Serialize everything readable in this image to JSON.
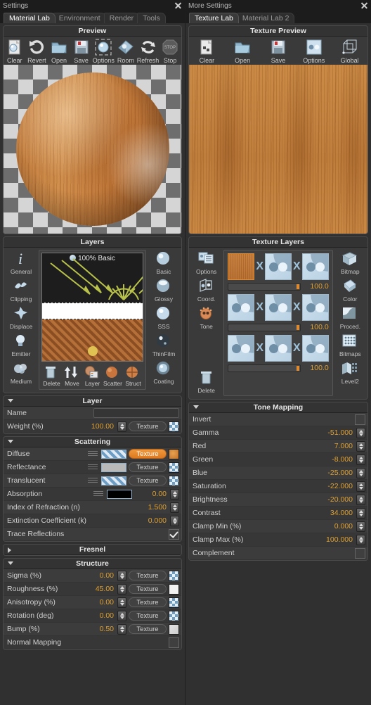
{
  "left_window": {
    "title": "Settings",
    "close_icon": "close-icon",
    "tabs": [
      {
        "label": "Material Lab",
        "active": true
      },
      {
        "label": "Environment",
        "active": false
      },
      {
        "label": "Render",
        "active": false
      },
      {
        "label": "Tools",
        "active": false
      }
    ],
    "preview": {
      "header": "Preview",
      "tools": [
        {
          "label": "Clear",
          "icon": "clear-icon"
        },
        {
          "label": "Revert",
          "icon": "revert-icon"
        },
        {
          "label": "Open",
          "icon": "folder-open-icon"
        },
        {
          "label": "Save",
          "icon": "floppy-save-icon"
        },
        {
          "label": "Options",
          "icon": "options-sphere-icon"
        },
        {
          "label": "Room",
          "icon": "room-icon"
        },
        {
          "label": "Refresh",
          "icon": "refresh-icon"
        },
        {
          "label": "Stop",
          "icon": "stop-icon"
        }
      ]
    },
    "layers": {
      "header": "Layers",
      "left_icons": [
        {
          "label": "General",
          "icon": "info-i-icon"
        },
        {
          "label": "Clipping",
          "icon": "clipping-leaf-icon"
        },
        {
          "label": "Displace",
          "icon": "displace-icon"
        },
        {
          "label": "Emitter",
          "icon": "lightbulb-icon"
        },
        {
          "label": "Medium",
          "icon": "medium-cloud-icon"
        }
      ],
      "right_icons": [
        {
          "label": "Basic",
          "icon": "basic-sphere-icon"
        },
        {
          "label": "Glossy",
          "icon": "glossy-sphere-icon"
        },
        {
          "label": "SSS",
          "icon": "sss-sphere-icon"
        },
        {
          "label": "ThinFilm",
          "icon": "thinfilm-sphere-icon"
        },
        {
          "label": "Coating",
          "icon": "coating-sphere-icon"
        }
      ],
      "diagram_label": "100% Basic",
      "bottom_buttons": [
        {
          "label": "Delete",
          "icon": "trash-icon"
        },
        {
          "label": "Move",
          "icon": "move-arrows-icon"
        },
        {
          "label": "Layer",
          "icon": "layer-icon"
        },
        {
          "label": "Scatter",
          "icon": "scatter-sphere-icon"
        },
        {
          "label": "Struct",
          "icon": "struct-sphere-icon"
        }
      ]
    },
    "layer_section": {
      "header": "Layer",
      "name_label": "Name",
      "name_value": "",
      "weight_label": "Weight (%)",
      "weight_value": "100.00",
      "weight_texture_button": "Texture"
    },
    "scattering": {
      "header": "Scattering",
      "rows": [
        {
          "label": "Diffuse",
          "type": "color_texture",
          "swatch": "stripe",
          "texture_button": "Texture",
          "texture_on": true,
          "thumb": "orange"
        },
        {
          "label": "Reflectance",
          "type": "color_texture",
          "swatch": "grey",
          "texture_button": "Texture",
          "texture_on": false,
          "thumb": "check"
        },
        {
          "label": "Translucent",
          "type": "color_texture",
          "swatch": "stripe",
          "texture_button": "Texture",
          "texture_on": false,
          "thumb": "check"
        },
        {
          "label": "Absorption",
          "type": "color_value",
          "swatch": "black",
          "value": "0.00"
        },
        {
          "label": "Index of Refraction (n)",
          "type": "value",
          "value": "1.500"
        },
        {
          "label": "Extinction Coefficient (k)",
          "type": "value",
          "value": "0.000"
        },
        {
          "label": "Trace Reflections",
          "type": "check",
          "checked": true
        }
      ]
    },
    "fresnel": {
      "header": "Fresnel",
      "collapsed": true
    },
    "structure": {
      "header": "Structure",
      "rows": [
        {
          "label": "Sigma (%)",
          "value": "0.00",
          "texture_button": "Texture",
          "thumb": "check"
        },
        {
          "label": "Roughness (%)",
          "value": "45.00",
          "texture_button": "Texture",
          "thumb": "white"
        },
        {
          "label": "Anisotropy (%)",
          "value": "0.00",
          "texture_button": "Texture",
          "thumb": "check"
        },
        {
          "label": "Rotation (deg)",
          "value": "0.00",
          "texture_button": "Texture",
          "thumb": "check"
        },
        {
          "label": "Bump (%)",
          "value": "0.50",
          "texture_button": "Texture",
          "thumb": "noise"
        }
      ],
      "normal_mapping_label": "Normal Mapping",
      "normal_mapping_checked": false
    }
  },
  "right_window": {
    "title": "More Settings",
    "close_icon": "close-icon",
    "tabs": [
      {
        "label": "Texture Lab",
        "active": true
      },
      {
        "label": "Material Lab 2",
        "active": false
      }
    ],
    "texture_preview": {
      "header": "Texture Preview",
      "tools": [
        {
          "label": "Clear",
          "icon": "clear-icon"
        },
        {
          "label": "Open",
          "icon": "folder-open-icon"
        },
        {
          "label": "Save",
          "icon": "floppy-save-icon"
        },
        {
          "label": "Options",
          "icon": "options-yinyang-icon"
        },
        {
          "label": "Global",
          "icon": "global-grid-icon"
        }
      ]
    },
    "texture_layers": {
      "header": "Texture Layers",
      "left_icons": [
        {
          "label": "Options",
          "icon": "options-panel-icon"
        },
        {
          "label": "Coord.",
          "icon": "coordinates-icon"
        },
        {
          "label": "Tone",
          "icon": "tone-face-icon"
        },
        {
          "label": "Delete",
          "icon": "trash-icon"
        }
      ],
      "right_icons": [
        {
          "label": "Bitmap",
          "icon": "bitmap-icon"
        },
        {
          "label": "Color",
          "icon": "color-bucket-icon"
        },
        {
          "label": "Proced.",
          "icon": "procedural-icon"
        },
        {
          "label": "Bitmaps",
          "icon": "bitmaps-grid-icon"
        },
        {
          "label": "Level2",
          "icon": "level2-icon"
        }
      ],
      "rows": [
        {
          "slots": [
            "wood",
            "yin",
            "yin"
          ],
          "slider_value": "100.0"
        },
        {
          "slots": [
            "yin",
            "yin",
            "yin"
          ],
          "slider_value": "100.0"
        },
        {
          "slots": [
            "yin",
            "yin",
            "yin"
          ],
          "slider_value": "100.0"
        }
      ],
      "operator": "X"
    },
    "tone_mapping": {
      "header": "Tone Mapping",
      "invert_label": "Invert",
      "invert_checked": false,
      "rows": [
        {
          "label": "Gamma",
          "value": "-51.000"
        },
        {
          "label": "Red",
          "value": "7.000"
        },
        {
          "label": "Green",
          "value": "-8.000"
        },
        {
          "label": "Blue",
          "value": "-25.000"
        },
        {
          "label": "Saturation",
          "value": "-22.000"
        },
        {
          "label": "Brightness",
          "value": "-20.000"
        },
        {
          "label": "Contrast",
          "value": "34.000"
        },
        {
          "label": "Clamp Min (%)",
          "value": "0.000"
        },
        {
          "label": "Clamp Max (%)",
          "value": "100.000"
        }
      ],
      "complement_label": "Complement",
      "complement_checked": false
    }
  },
  "colors": {
    "accent_orange": "#e0a030",
    "panel_bg": "#3a3a3a",
    "window_bg": "#303030",
    "titlebar_bg": "#1c1c1c",
    "text": "#cfcfcf",
    "link_blue": "#9fc3dc"
  }
}
